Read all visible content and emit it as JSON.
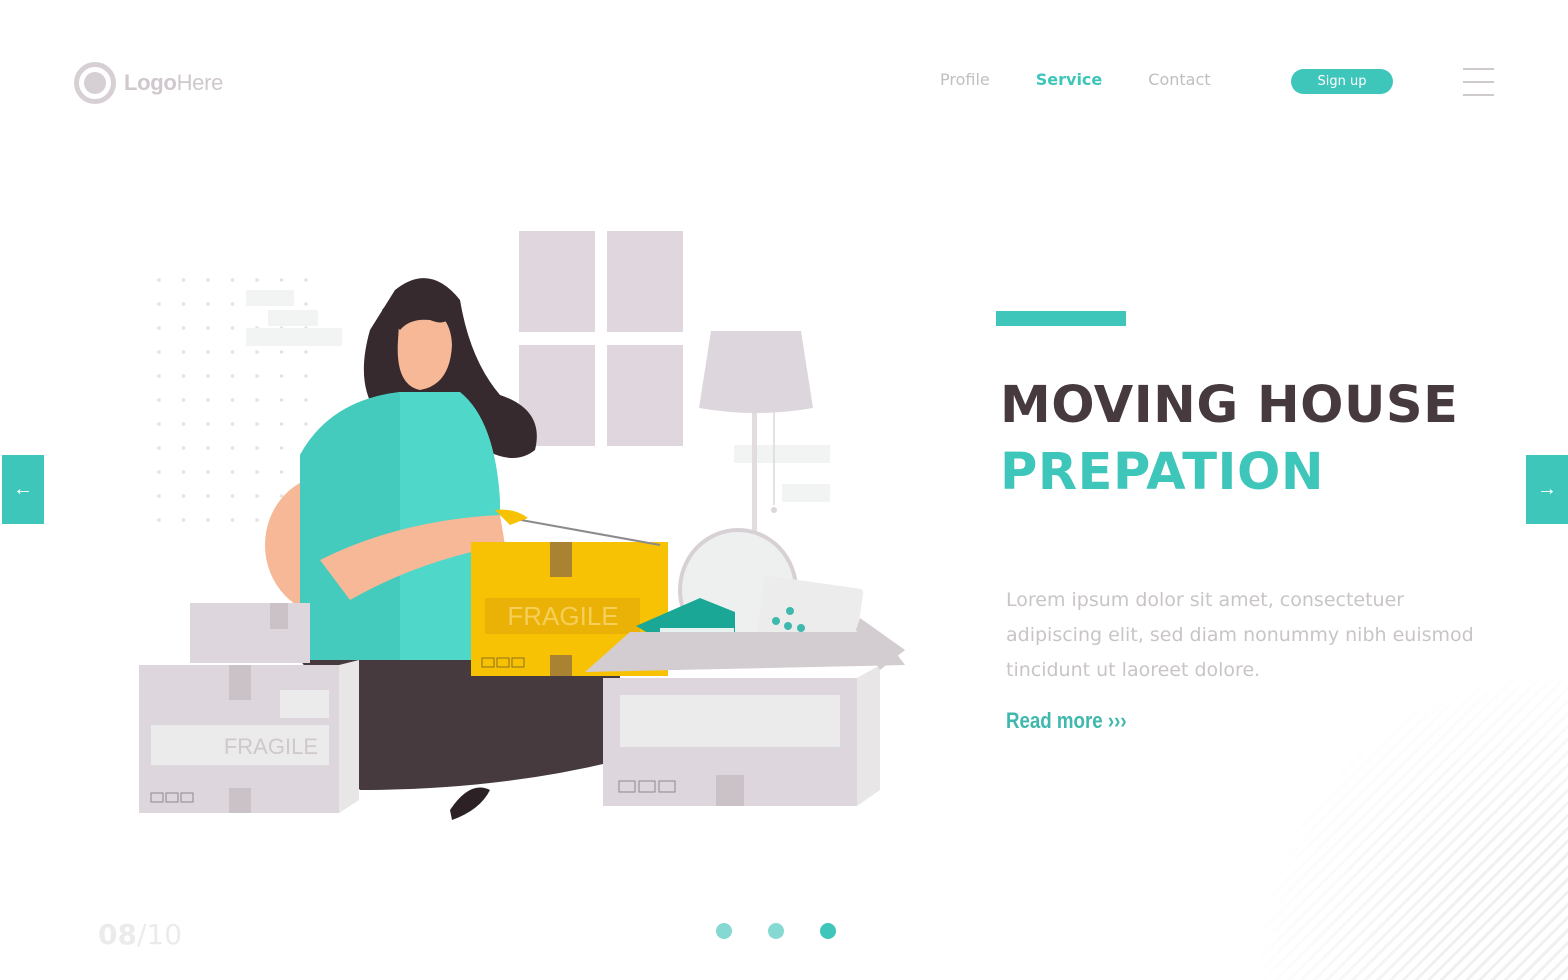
{
  "header": {
    "logo": {
      "bold": "Logo",
      "light": "Here"
    },
    "nav": [
      {
        "label": "Profile",
        "active": false
      },
      {
        "label": "Service",
        "active": true
      },
      {
        "label": "Contact",
        "active": false
      }
    ],
    "signup_label": "Sign up",
    "menu_icon": "hamburger-icon"
  },
  "hero": {
    "title_line1": "MOVING HOUSE",
    "title_line2": "PREPATION",
    "description": "Lorem ipsum dolor sit amet, consectetuer adipiscing elit, sed diam nonummy nibh euismod tincidunt ut laoreet dolore.",
    "read_more_label": "Read more",
    "read_more_icon": "›››"
  },
  "illustration": {
    "box_label_left": "FRAGILE",
    "box_label_yellow": "FRAGILE"
  },
  "navigation": {
    "prev_icon": "←",
    "next_icon": "→"
  },
  "pager": {
    "current": "08",
    "separator": "/",
    "total": "10",
    "dots": 3,
    "active_dot": 3
  },
  "colors": {
    "accent": "#3fc6ba",
    "title_dark": "#463a3f",
    "muted_text": "#c9c5c7"
  }
}
